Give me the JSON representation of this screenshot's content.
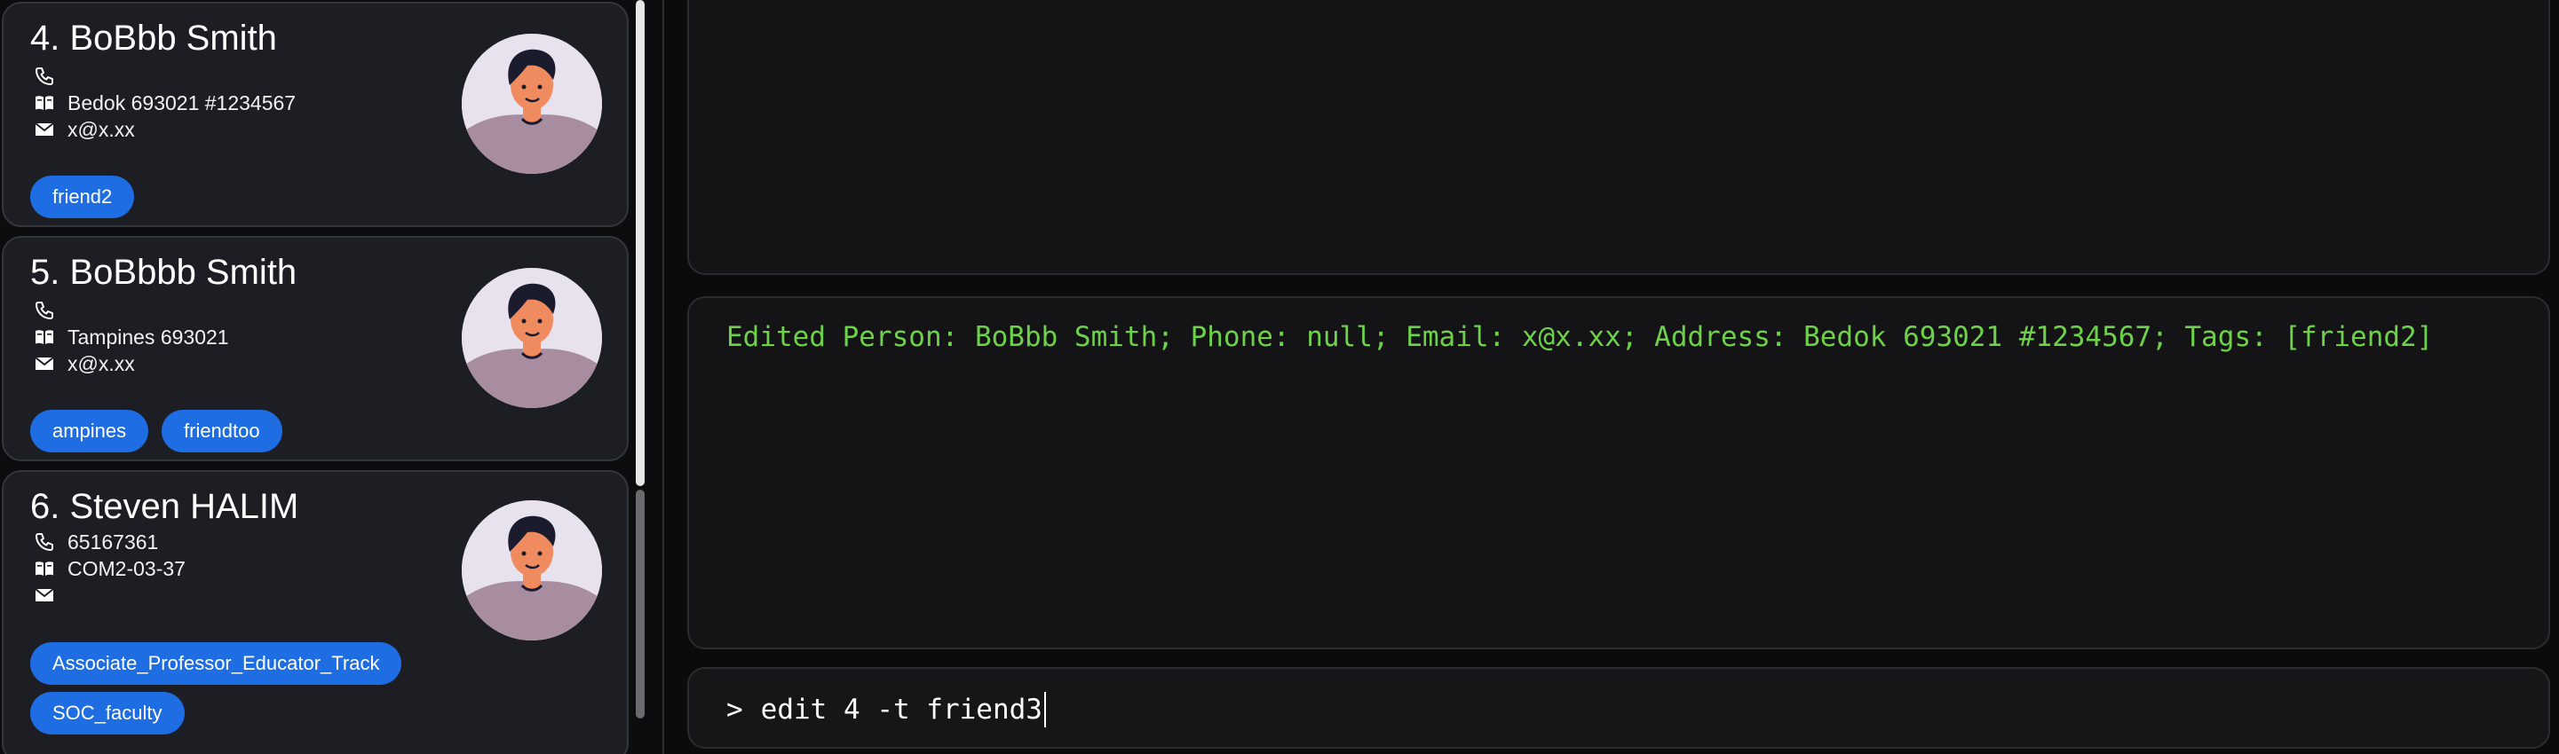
{
  "persons": [
    {
      "name": "4. BoBbb Smith",
      "phone": "",
      "address": "Bedok 693021 #1234567",
      "email": "x@x.xx",
      "tags": [
        "friend2"
      ]
    },
    {
      "name": "5. BoBbbb Smith",
      "phone": "",
      "address": "Tampines 693021",
      "email": "x@x.xx",
      "tags": [
        "ampines",
        "friendtoo"
      ]
    },
    {
      "name": "6. Steven HALIM",
      "phone": "65167361",
      "address": "COM2-03-37",
      "email": "",
      "tags": [
        "Associate_Professor_Educator_Track",
        "SOC_faculty"
      ]
    }
  ],
  "result": {
    "text": "Edited Person: BoBbb Smith; Phone: null; Email: x@x.xx; Address: Bedok 693021 #1234567; Tags: [friend2]"
  },
  "command": {
    "prompt": ">",
    "value": "edit 4 -t friend3"
  },
  "colors": {
    "tag": "#1f6de3",
    "result_text": "#6dd24a",
    "card": "#1d1e23",
    "pane": "#141416"
  },
  "icons": {
    "phone": "phone-icon",
    "address": "address-book-icon",
    "email": "envelope-icon",
    "avatar": "person-avatar-icon"
  }
}
